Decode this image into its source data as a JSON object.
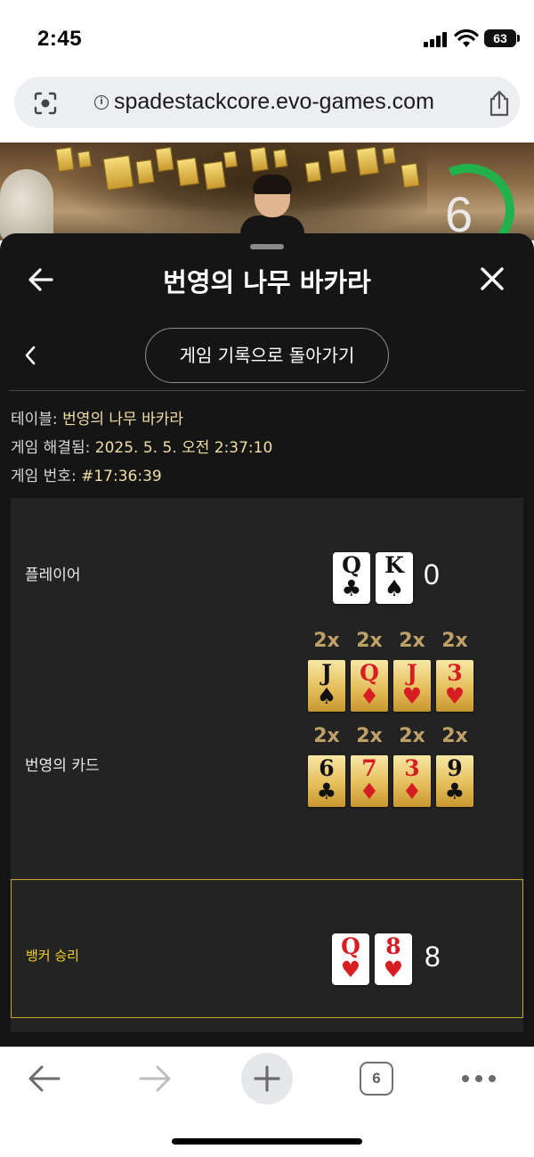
{
  "status": {
    "time": "2:45",
    "battery": "63"
  },
  "browser": {
    "url": "spadestackcore.evo-games.com",
    "tab_count": "6"
  },
  "video": {
    "timer": "6"
  },
  "sheet": {
    "title": "번영의 나무 바카라",
    "back_to_history": "게임 기록으로 돌아가기",
    "table_key": "테이블:",
    "table_value": "번영의 나무 바카라",
    "resolved_key": "게임 해결됨:",
    "resolved_value": "2025. 5. 5. 오전 2:37:10",
    "number_key": "게임 번호:",
    "number_value": "#17:36:39"
  },
  "result": {
    "player": {
      "label": "플레이어",
      "score": "0",
      "cards": [
        {
          "rank": "Q",
          "suit": "♣",
          "color": "#111111"
        },
        {
          "rank": "K",
          "suit": "♠",
          "color": "#111111"
        }
      ]
    },
    "prosperity": {
      "label": "번영의 카드",
      "rows": [
        [
          {
            "mult": "2x",
            "rank": "J",
            "suit": "♠",
            "color": "#111111"
          },
          {
            "mult": "2x",
            "rank": "Q",
            "suit": "♦",
            "color": "#d61d22"
          },
          {
            "mult": "2x",
            "rank": "J",
            "suit": "♥",
            "color": "#d61d22"
          },
          {
            "mult": "2x",
            "rank": "3",
            "suit": "♥",
            "color": "#d61d22"
          }
        ],
        [
          {
            "mult": "2x",
            "rank": "6",
            "suit": "♣",
            "color": "#111111"
          },
          {
            "mult": "2x",
            "rank": "7",
            "suit": "♦",
            "color": "#d61d22"
          },
          {
            "mult": "2x",
            "rank": "3",
            "suit": "♦",
            "color": "#d61d22"
          },
          {
            "mult": "2x",
            "rank": "9",
            "suit": "♣",
            "color": "#111111"
          }
        ]
      ]
    },
    "banker": {
      "label": "뱅커 승리",
      "score": "8",
      "cards": [
        {
          "rank": "Q",
          "suit": "♥",
          "color": "#d61d22"
        },
        {
          "rank": "8",
          "suit": "♥",
          "color": "#d61d22"
        }
      ]
    }
  },
  "colors": {
    "accent_gold": "#c9a92a",
    "win_label": "#f0d12a",
    "timer_green": "#22b24c"
  },
  "icons": [
    "lens-icon",
    "info-icon",
    "share-icon",
    "back-arrow-icon",
    "close-icon",
    "chevron-left-icon",
    "nav-back-icon",
    "nav-forward-icon",
    "new-tab-plus-icon",
    "tabs-icon",
    "more-icon"
  ]
}
